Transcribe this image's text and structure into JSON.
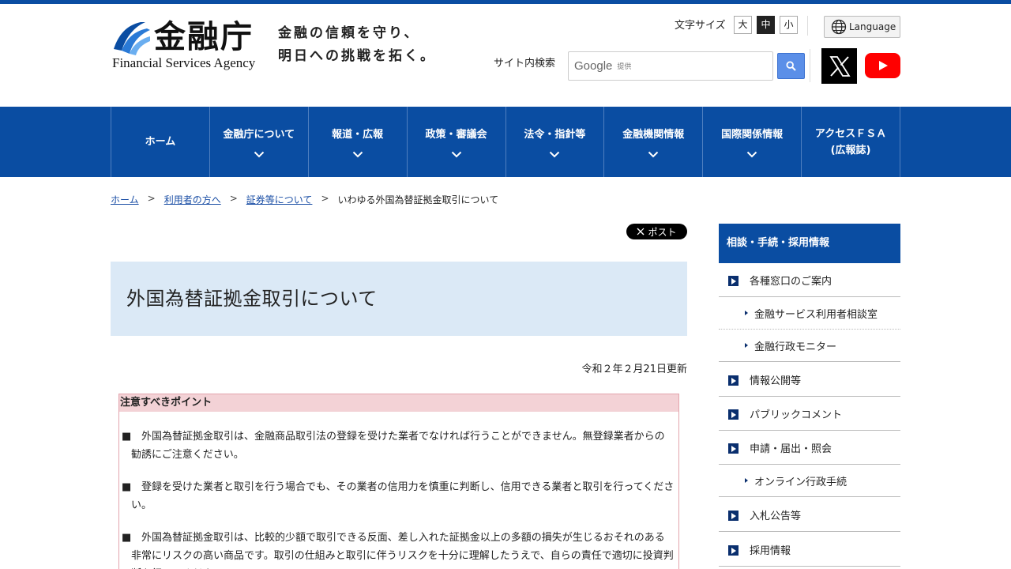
{
  "header": {
    "logo_jp": "金融庁",
    "logo_en": "Financial Services Agency",
    "tagline_line1": "金融の信頼を守り、",
    "tagline_line2": "明日への挑戦を拓く。",
    "font_size_label": "文字サイズ",
    "font_sizes": [
      "大",
      "中",
      "小"
    ],
    "font_size_selected": "中",
    "language_label": "Language",
    "search_label": "サイト内検索",
    "search_logo": "Google",
    "search_provider": "提供"
  },
  "nav": {
    "items": [
      {
        "label": "ホーム",
        "has_dropdown": false
      },
      {
        "label": "金融庁について",
        "has_dropdown": true
      },
      {
        "label": "報道・広報",
        "has_dropdown": true
      },
      {
        "label": "政策・審議会",
        "has_dropdown": true
      },
      {
        "label": "法令・指針等",
        "has_dropdown": true
      },
      {
        "label": "金融機関情報",
        "has_dropdown": true
      },
      {
        "label": "国際関係情報",
        "has_dropdown": true
      },
      {
        "label": "アクセスＦＳＡ\n(広報誌)",
        "has_dropdown": false
      }
    ]
  },
  "breadcrumb": {
    "items": [
      "ホーム",
      "利用者の方へ",
      "証券等について"
    ],
    "current": "いわゆる外国為替証拠金取引について",
    "separator": ">"
  },
  "main": {
    "post_label": "ポスト",
    "title": "外国為替証拠金取引について",
    "updated": "令和２年２月21日更新",
    "notice": {
      "heading": "注意すべきポイント",
      "bullet": "■",
      "items": [
        "外国為替証拠金取引は、金融商品取引法の登録を受けた業者でなければ行うことができません。無登録業者からの勧誘にご注意ください。",
        "登録を受けた業者と取引を行う場合でも、その業者の信用力を慎重に判断し、信用できる業者と取引を行ってください。",
        "外国為替証拠金取引は、比較的少額で取引できる反面、差し入れた証拠金以上の多額の損失が生じるおそれのある非常にリスクの高い商品です。取引の仕組みと取引に伴うリスクを十分に理解したうえで、自らの責任で適切に投資判断を行ってください。"
      ]
    }
  },
  "sidebar": {
    "heading": "相談・手続・採用情報",
    "items": [
      {
        "label": "各種窓口のご案内",
        "level": 1
      },
      {
        "label": "金融サービス利用者相談室",
        "level": 2
      },
      {
        "label": "金融行政モニター",
        "level": 2
      },
      {
        "label": "情報公開等",
        "level": 1
      },
      {
        "label": "パブリックコメント",
        "level": 1
      },
      {
        "label": "申請・届出・照会",
        "level": 1
      },
      {
        "label": "オンライン行政手続",
        "level": 2
      },
      {
        "label": "入札公告等",
        "level": 1
      },
      {
        "label": "採用情報",
        "level": 1
      }
    ]
  },
  "colors": {
    "brand_blue": "#0a4da2",
    "title_bg": "#dbe9f6",
    "notice_border": "#e3a4ad",
    "notice_head_bg": "#f3d2d6"
  }
}
